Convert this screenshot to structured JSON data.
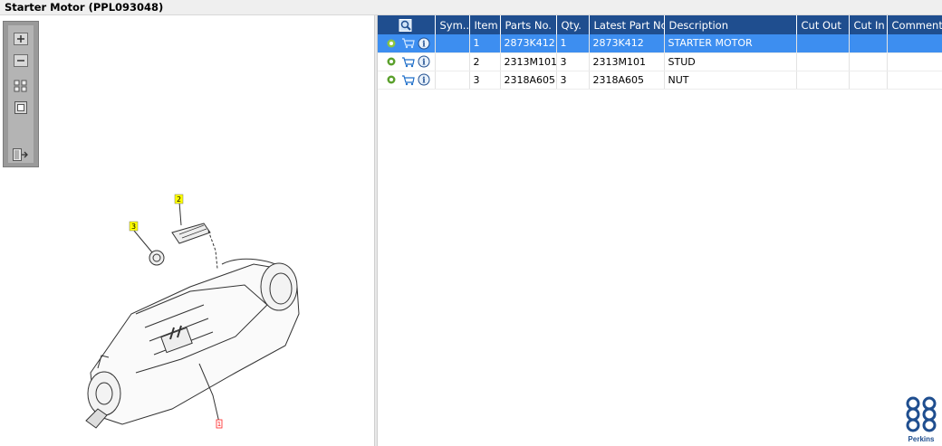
{
  "window": {
    "title": "Starter Motor (PPL093048)"
  },
  "toolbar": {
    "buttons": [
      "zoom-in",
      "zoom-out",
      "fit-all",
      "fit-window",
      "export"
    ]
  },
  "drawing": {
    "callouts": [
      {
        "label": "2",
        "color": "#ffff00"
      },
      {
        "label": "3",
        "color": "#ffff00"
      },
      {
        "label": "1",
        "color": "#ff2020"
      }
    ]
  },
  "table": {
    "columns": [
      "",
      "Sym...",
      "Item",
      "Parts No.",
      "Qty.",
      "Latest Part No.",
      "Description",
      "Cut Out",
      "Cut In",
      "Comment"
    ],
    "rows": [
      {
        "symbol": "",
        "item": "1",
        "parts_no": "2873K412",
        "qty": "1",
        "latest_part_no": "2873K412",
        "description": "STARTER MOTOR",
        "cut_out": "",
        "cut_in": "",
        "comment": "",
        "selected": true
      },
      {
        "symbol": "",
        "item": "2",
        "parts_no": "2313M101",
        "qty": "3",
        "latest_part_no": "2313M101",
        "description": "STUD",
        "cut_out": "",
        "cut_in": "",
        "comment": "",
        "selected": false
      },
      {
        "symbol": "",
        "item": "3",
        "parts_no": "2318A605",
        "qty": "3",
        "latest_part_no": "2318A605",
        "description": "NUT",
        "cut_out": "",
        "cut_in": "",
        "comment": "",
        "selected": false
      }
    ]
  },
  "logo": {
    "text": "Perkins"
  },
  "colors": {
    "header": "#1f4e8f",
    "selection": "#3d8ef0",
    "accent_green": "#5aa02c"
  }
}
